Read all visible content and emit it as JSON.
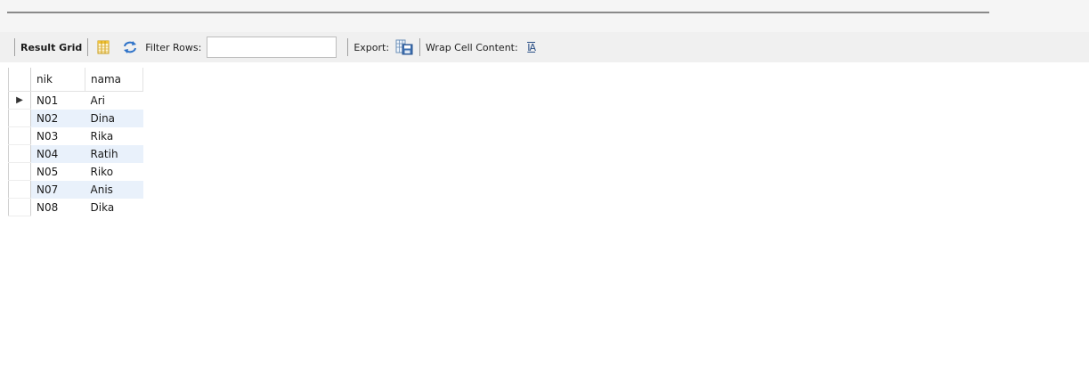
{
  "toolbar": {
    "result_grid_label": "Result Grid",
    "filter_label": "Filter Rows:",
    "filter_value": "",
    "export_label": "Export:",
    "wrap_label": "Wrap Cell Content:",
    "wrap_icon_text": "IA"
  },
  "grid": {
    "columns": [
      "nik",
      "nama"
    ],
    "current_row_marker": "▶",
    "rows": [
      {
        "nik": "N01",
        "nama": "Ari"
      },
      {
        "nik": "N02",
        "nama": "Dina"
      },
      {
        "nik": "N03",
        "nama": "Rika"
      },
      {
        "nik": "N04",
        "nama": "Ratih"
      },
      {
        "nik": "N05",
        "nama": "Riko"
      },
      {
        "nik": "N07",
        "nama": "Anis"
      },
      {
        "nik": "N08",
        "nama": "Dika"
      }
    ]
  },
  "icons": {
    "grid_view": "grid-columns-icon",
    "refresh": "refresh-arrows-icon",
    "export": "export-grid-save-icon",
    "wrap": "wrap-text-icon"
  },
  "colors": {
    "toolbar_bg": "#f0f0f0",
    "alt_row_bg": "#e9f1fb",
    "refresh_blue": "#2f73c8",
    "grid_icon_yellow": "#f2c43a"
  }
}
